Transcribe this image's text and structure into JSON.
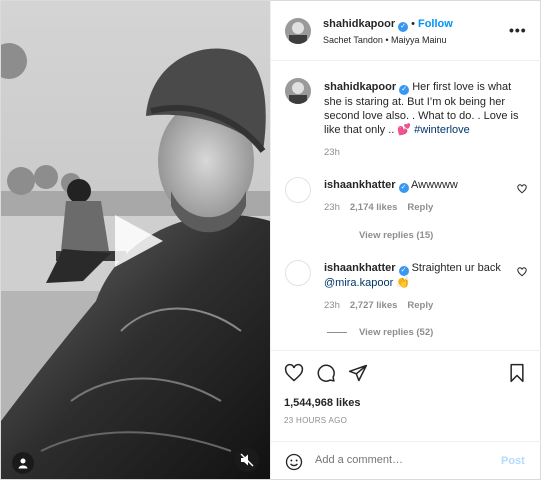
{
  "header": {
    "username": "shahidkapoor",
    "separator": "•",
    "follow_label": "Follow",
    "subtitle": "Sachet Tandon • Maiyya Mainu",
    "more_label": "•••"
  },
  "caption": {
    "username": "shahidkapoor",
    "text": "Her first love is what she is staring at. But I’m ok being her second love also. . What to do. . Love is like that only .. 💕",
    "hashtag": "#winterlove",
    "time": "23h"
  },
  "comments": [
    {
      "username": "ishaankhatter",
      "text": "Awwwww",
      "mention": "",
      "emoji": "",
      "time": "23h",
      "likes": "2,174 likes",
      "reply_label": "Reply",
      "view_replies": "View replies (15)"
    },
    {
      "username": "ishaankhatter",
      "text": "Straighten ur back",
      "mention": "@mira.kapoor",
      "emoji": "👏",
      "time": "23h",
      "likes": "2,727 likes",
      "reply_label": "Reply",
      "view_replies": "View replies (52)"
    }
  ],
  "actions": {
    "likes": "1,544,968 likes",
    "posted": "23 HOURS AGO"
  },
  "add_comment": {
    "placeholder": "Add a comment…",
    "post_label": "Post"
  },
  "icons": [
    "play-icon",
    "user-tag-icon",
    "mute-icon",
    "verified-icon",
    "more-icon",
    "heart-icon",
    "comment-icon",
    "share-icon",
    "bookmark-icon",
    "emoji-icon"
  ],
  "colors": {
    "accent": "#0095f6",
    "post_disabled": "#b3dbff",
    "verified": "#3897f0",
    "muted_text": "#8e8e8e"
  }
}
